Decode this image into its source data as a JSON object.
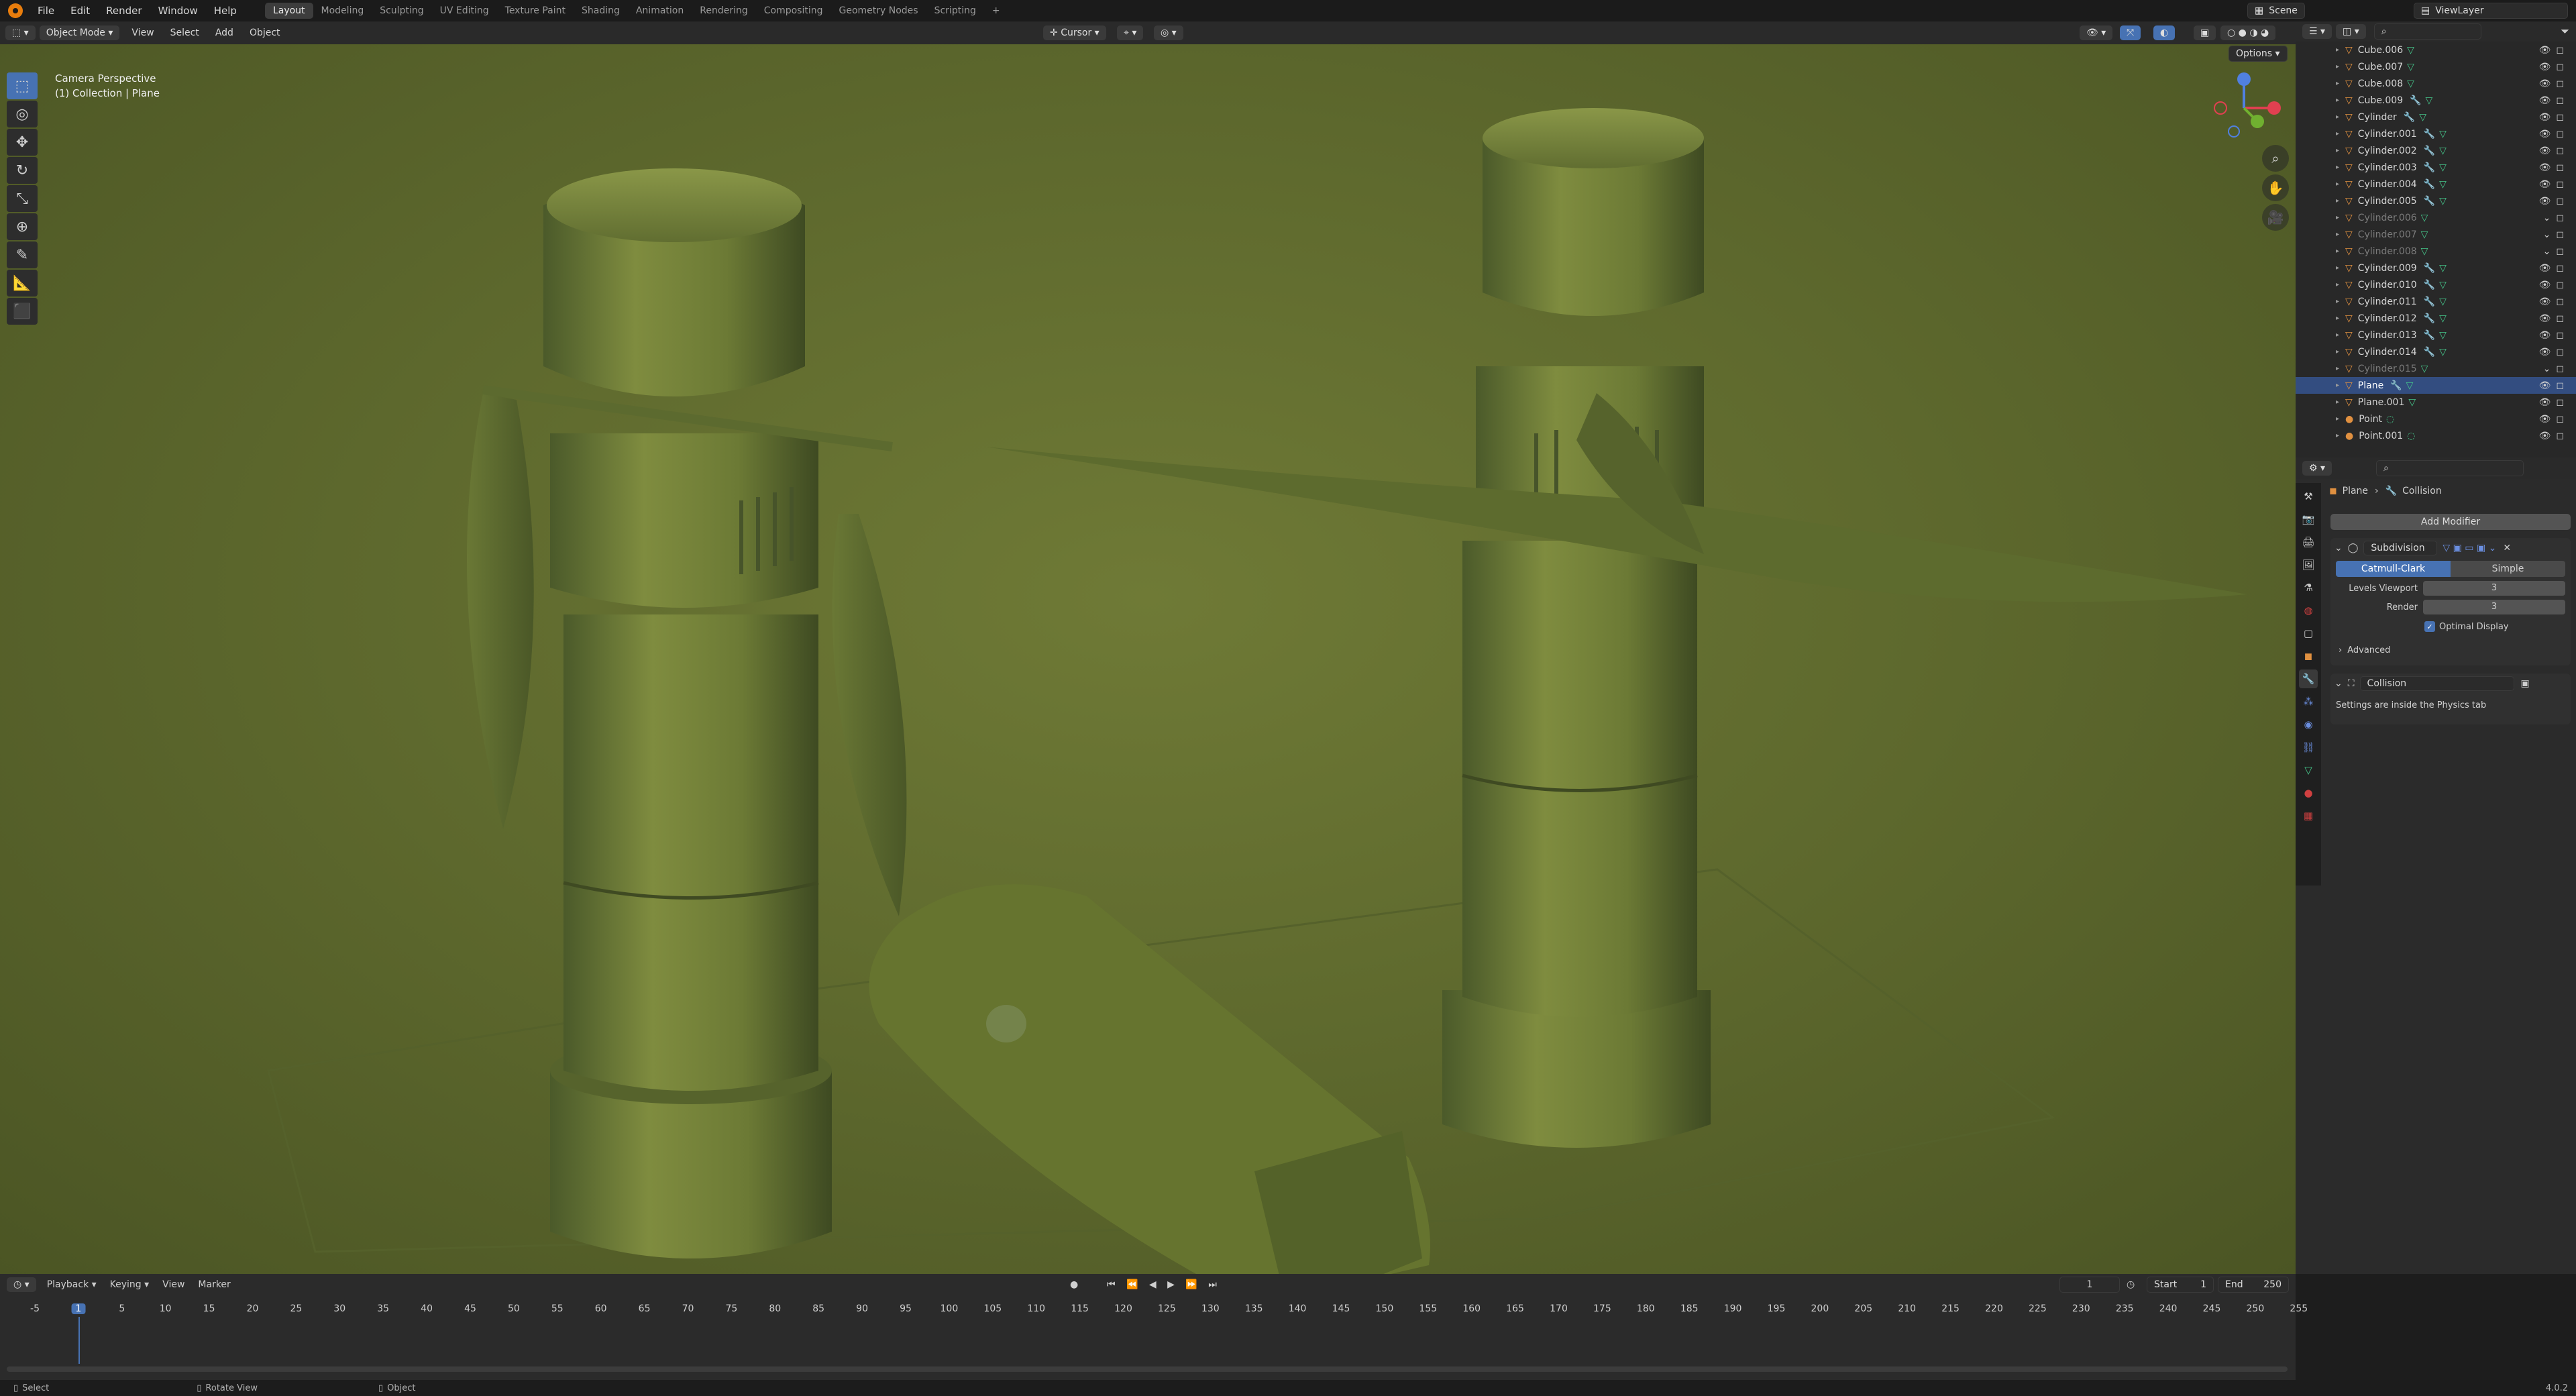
{
  "topbar": {
    "menus": [
      "File",
      "Edit",
      "Render",
      "Window",
      "Help"
    ],
    "workspaces": [
      "Layout",
      "Modeling",
      "Sculpting",
      "UV Editing",
      "Texture Paint",
      "Shading",
      "Animation",
      "Rendering",
      "Compositing",
      "Geometry Nodes",
      "Scripting"
    ],
    "active_workspace": "Layout",
    "add_workspace": "+",
    "scene_label": "Scene",
    "viewlayer_label": "ViewLayer"
  },
  "viewport_header": {
    "mode": "Object Mode",
    "menus": [
      "View",
      "Select",
      "Add",
      "Object"
    ],
    "pivot": "Cursor",
    "options": "Options"
  },
  "viewport": {
    "camera_text": "Camera Perspective",
    "collection_text": "(1) Collection | Plane",
    "gizmo_axes": [
      "X",
      "Y",
      "Z"
    ]
  },
  "outliner": {
    "rows": [
      {
        "name": "Cube.006",
        "dim": false,
        "mod": false
      },
      {
        "name": "Cube.007",
        "dim": false,
        "mod": false
      },
      {
        "name": "Cube.008",
        "dim": false,
        "mod": false
      },
      {
        "name": "Cube.009",
        "dim": false,
        "mod": true
      },
      {
        "name": "Cylinder",
        "dim": false,
        "mod": true
      },
      {
        "name": "Cylinder.001",
        "dim": false,
        "mod": true
      },
      {
        "name": "Cylinder.002",
        "dim": false,
        "mod": true
      },
      {
        "name": "Cylinder.003",
        "dim": false,
        "mod": true
      },
      {
        "name": "Cylinder.004",
        "dim": false,
        "mod": true
      },
      {
        "name": "Cylinder.005",
        "dim": false,
        "mod": true
      },
      {
        "name": "Cylinder.006",
        "dim": true,
        "mod": false
      },
      {
        "name": "Cylinder.007",
        "dim": true,
        "mod": false
      },
      {
        "name": "Cylinder.008",
        "dim": true,
        "mod": false
      },
      {
        "name": "Cylinder.009",
        "dim": false,
        "mod": true
      },
      {
        "name": "Cylinder.010",
        "dim": false,
        "mod": true
      },
      {
        "name": "Cylinder.011",
        "dim": false,
        "mod": true
      },
      {
        "name": "Cylinder.012",
        "dim": false,
        "mod": true
      },
      {
        "name": "Cylinder.013",
        "dim": false,
        "mod": true
      },
      {
        "name": "Cylinder.014",
        "dim": false,
        "mod": true
      },
      {
        "name": "Cylinder.015",
        "dim": true,
        "mod": false
      },
      {
        "name": "Plane",
        "dim": false,
        "mod": true,
        "selected": true
      },
      {
        "name": "Plane.001",
        "dim": false,
        "mod": false
      },
      {
        "name": "Point",
        "dim": false,
        "mod": false,
        "light": true
      },
      {
        "name": "Point.001",
        "dim": false,
        "mod": false,
        "light": true
      }
    ]
  },
  "properties": {
    "breadcrumb_object": "Plane",
    "breadcrumb_modifier": "Collision",
    "add_modifier": "Add Modifier",
    "subdivision": {
      "name": "Subdivision",
      "type_options": [
        "Catmull-Clark",
        "Simple"
      ],
      "active_type": "Catmull-Clark",
      "levels_viewport_label": "Levels Viewport",
      "levels_viewport": "3",
      "render_label": "Render",
      "render": "3",
      "optimal_display": "Optimal Display",
      "advanced": "Advanced"
    },
    "collision": {
      "name": "Collision",
      "info": "Settings are inside the Physics tab"
    }
  },
  "timeline": {
    "menus": [
      "Playback",
      "Keying",
      "View",
      "Marker"
    ],
    "current_frame": "1",
    "start_label": "Start",
    "start": "1",
    "end_label": "End",
    "end": "250",
    "ticks": [
      "-5",
      "1",
      "5",
      "10",
      "15",
      "20",
      "25",
      "30",
      "35",
      "40",
      "45",
      "50",
      "55",
      "60",
      "65",
      "70",
      "75",
      "80",
      "85",
      "90",
      "95",
      "100",
      "105",
      "110",
      "115",
      "120",
      "125",
      "130",
      "135",
      "140",
      "145",
      "150",
      "155",
      "160",
      "165",
      "170",
      "175",
      "180",
      "185",
      "190",
      "195",
      "200",
      "205",
      "210",
      "215",
      "220",
      "225",
      "230",
      "235",
      "240",
      "245",
      "250",
      "255"
    ]
  },
  "statusbar": {
    "select": "Select",
    "rotate": "Rotate View",
    "object": "Object",
    "version": "4.0.2"
  },
  "colors": {
    "accent": "#4772b3",
    "selection": "#334d80",
    "mesh_icon": "#e09040",
    "viewport_bg": "#6f7a36"
  }
}
